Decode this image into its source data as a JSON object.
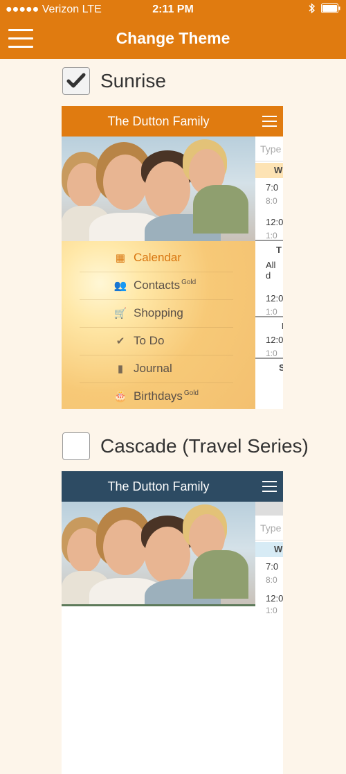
{
  "status_bar": {
    "signal": "●●●●● Verizon  LTE",
    "time": "2:11 PM",
    "battery_icon": "battery-icon",
    "bluetooth_icon": "bluetooth-icon"
  },
  "navbar": {
    "title": "Change Theme"
  },
  "colors": {
    "accent": "#e07b10",
    "cascade": "#2d4b63",
    "background": "#fdf5ea"
  },
  "themes": [
    {
      "label": "Sunrise",
      "checked": true,
      "preview": {
        "header_title": "The Dutton Family",
        "menu_items": [
          {
            "icon": "calendar-icon",
            "label": "Calendar",
            "badge": ""
          },
          {
            "icon": "contacts-icon",
            "label": "Contacts",
            "badge": "Gold"
          },
          {
            "icon": "cart-icon",
            "label": "Shopping",
            "badge": ""
          },
          {
            "icon": "check-icon",
            "label": "To Do",
            "badge": ""
          },
          {
            "icon": "journal-icon",
            "label": "Journal",
            "badge": ""
          },
          {
            "icon": "cake-icon",
            "label": "Birthdays",
            "badge": "Gold"
          }
        ],
        "side_column": {
          "search_placeholder": "Type",
          "rows": [
            "W",
            "7:0",
            "8:0",
            "12:0",
            "1:0",
            "T",
            "All d",
            "12:0",
            "1:0",
            "I",
            "12:0",
            "1:0",
            "S"
          ]
        }
      }
    },
    {
      "label": "Cascade (Travel Series)",
      "checked": false,
      "preview": {
        "header_title": "The Dutton Family",
        "side_column": {
          "search_placeholder": "Type",
          "rows": [
            "W",
            "7:0",
            "8:0",
            "12:0",
            "1:0"
          ]
        }
      }
    }
  ]
}
